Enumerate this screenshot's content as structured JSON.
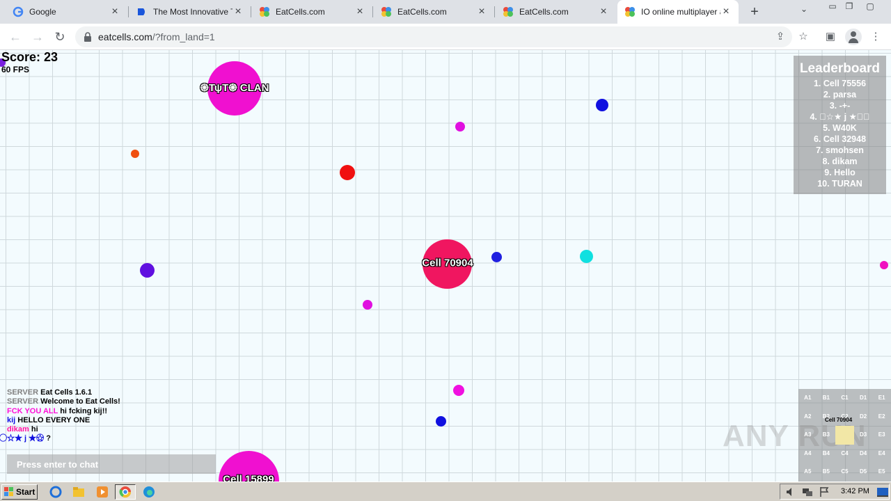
{
  "browser": {
    "tabs": [
      {
        "title": "Google",
        "icon": "google-icon"
      },
      {
        "title": "The Most Innovative Tr",
        "icon": "site-icon"
      },
      {
        "title": "EatCells.com",
        "icon": "eatcells-icon"
      },
      {
        "title": "EatCells.com",
        "icon": "eatcells-icon"
      },
      {
        "title": "EatCells.com",
        "icon": "eatcells-icon"
      },
      {
        "title": "IO online multiplayer ar",
        "icon": "eatcells-icon",
        "active": true
      }
    ],
    "url_host": "eatcells.com",
    "url_path": "/?from_land=1"
  },
  "game": {
    "score_text": "Score: 23",
    "fps_text": "60 FPS",
    "leaderboard": {
      "title": "Leaderboard",
      "entries": [
        "1. Cell 75556",
        "2. parsa",
        "3. -+-",
        "4. ⃝☆★ j ★☆⃝",
        "5. W40K",
        "6. Cell 32948",
        "7. smohsen",
        "8. dikam",
        "9. Hello",
        "10. TURAN"
      ]
    },
    "player_cells": [
      {
        "name": "Cell 70904",
        "color": "#f01660"
      },
      {
        "name": "֎ΤψΤ֎ CLAN",
        "color": "#f010d0"
      },
      {
        "name": "Cell 15899",
        "color": "#f010d0"
      }
    ],
    "chat": [
      {
        "sender": "SERVER",
        "message": "Eat Cells 1.6.1",
        "sender_color": "#808080"
      },
      {
        "sender": "SERVER",
        "message": "Welcome to Eat Cells!",
        "sender_color": "#808080"
      },
      {
        "sender": "FCK YOU ALL",
        "message": "hi fcking kij!!",
        "sender_color": "#ff10d8"
      },
      {
        "sender": "kij",
        "message": "HELLO EVERY ONE",
        "sender_color": "#1010e0"
      },
      {
        "sender": "dikam",
        "message": "hi",
        "sender_color": "#ff10a0"
      },
      {
        "sender": "⃝☆★ j ★☆⃝",
        "message": "?",
        "sender_color": "#1010e0"
      }
    ],
    "chat_placeholder": "Press enter to chat",
    "minimap": {
      "rows": [
        [
          "A1",
          "B1",
          "C1",
          "D1",
          "E1"
        ],
        [
          "A2",
          "B2",
          "C2",
          "D2",
          "E2"
        ],
        [
          "A3",
          "B3",
          "C3",
          "D3",
          "E3"
        ],
        [
          "A4",
          "B4",
          "C4",
          "D4",
          "E4"
        ],
        [
          "A5",
          "B5",
          "C5",
          "D5",
          "E5"
        ]
      ],
      "player_label": "Cell 70904"
    },
    "watermark": "ANY RUN"
  },
  "taskbar": {
    "start_label": "Start",
    "clock": "3:42 PM"
  }
}
